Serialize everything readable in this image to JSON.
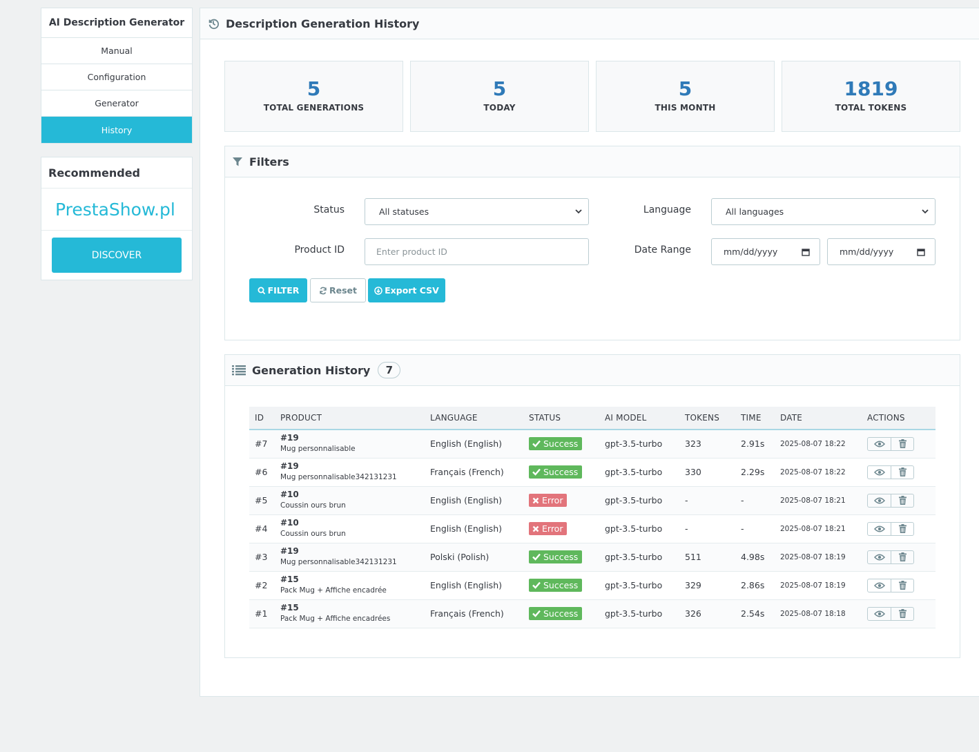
{
  "sidebar": {
    "title": "AI Description Generator",
    "items": [
      {
        "label": "Manual"
      },
      {
        "label": "Configuration"
      },
      {
        "label": "Generator"
      },
      {
        "label": "History"
      }
    ],
    "recommended": {
      "title": "Recommended",
      "brand": "PrestaShow.pl",
      "button": "DISCOVER"
    }
  },
  "page": {
    "title": "Description Generation History"
  },
  "stats": [
    {
      "value": "5",
      "label": "TOTAL GENERATIONS"
    },
    {
      "value": "5",
      "label": "TODAY"
    },
    {
      "value": "5",
      "label": "THIS MONTH"
    },
    {
      "value": "1819",
      "label": "TOTAL TOKENS"
    }
  ],
  "filters": {
    "title": "Filters",
    "status_label": "Status",
    "status_value": "All statuses",
    "language_label": "Language",
    "language_value": "All languages",
    "product_label": "Product ID",
    "product_placeholder": "Enter product ID",
    "date_label": "Date Range",
    "date_from": "mm/dd/yyyy",
    "date_to": "mm/dd/yyyy",
    "filter_button": "FILTER",
    "reset_button": "Reset",
    "export_button": "Export CSV"
  },
  "history": {
    "title": "Generation History",
    "count": "7",
    "columns": [
      "ID",
      "PRODUCT",
      "LANGUAGE",
      "STATUS",
      "AI MODEL",
      "TOKENS",
      "TIME",
      "DATE",
      "ACTIONS"
    ],
    "rows": [
      {
        "id": "#7",
        "pid": "#19",
        "pname": "Mug personnalisable",
        "lang": "English (English)",
        "status": "Success",
        "ok": true,
        "model": "gpt-3.5-turbo",
        "tokens": "323",
        "time": "2.91s",
        "date": "2025-08-07 18:22"
      },
      {
        "id": "#6",
        "pid": "#19",
        "pname": "Mug personnalisable342131231",
        "lang": "Français (French)",
        "status": "Success",
        "ok": true,
        "model": "gpt-3.5-turbo",
        "tokens": "330",
        "time": "2.29s",
        "date": "2025-08-07 18:22"
      },
      {
        "id": "#5",
        "pid": "#10",
        "pname": "Coussin ours brun",
        "lang": "English (English)",
        "status": "Error",
        "ok": false,
        "model": "gpt-3.5-turbo",
        "tokens": "-",
        "time": "-",
        "date": "2025-08-07 18:21"
      },
      {
        "id": "#4",
        "pid": "#10",
        "pname": "Coussin ours brun",
        "lang": "English (English)",
        "status": "Error",
        "ok": false,
        "model": "gpt-3.5-turbo",
        "tokens": "-",
        "time": "-",
        "date": "2025-08-07 18:21"
      },
      {
        "id": "#3",
        "pid": "#19",
        "pname": "Mug personnalisable342131231",
        "lang": "Polski (Polish)",
        "status": "Success",
        "ok": true,
        "model": "gpt-3.5-turbo",
        "tokens": "511",
        "time": "4.98s",
        "date": "2025-08-07 18:19"
      },
      {
        "id": "#2",
        "pid": "#15",
        "pname": "Pack Mug + Affiche encadrée",
        "lang": "English (English)",
        "status": "Success",
        "ok": true,
        "model": "gpt-3.5-turbo",
        "tokens": "329",
        "time": "2.86s",
        "date": "2025-08-07 18:19"
      },
      {
        "id": "#1",
        "pid": "#15",
        "pname": "Pack Mug + Affiche encadrées",
        "lang": "Français (French)",
        "status": "Success",
        "ok": true,
        "model": "gpt-3.5-turbo",
        "tokens": "326",
        "time": "2.54s",
        "date": "2025-08-07 18:18"
      }
    ]
  },
  "icons": {
    "history": "history-icon",
    "filter": "funnel-icon",
    "list": "list-icon",
    "view": "eye-icon",
    "delete": "trash-icon",
    "success": "check-icon",
    "error": "x-icon"
  },
  "colors": {
    "accent": "#25b9d7",
    "stat_number": "#2f7ab8",
    "success": "#5fb85c",
    "error": "#e2747b"
  }
}
